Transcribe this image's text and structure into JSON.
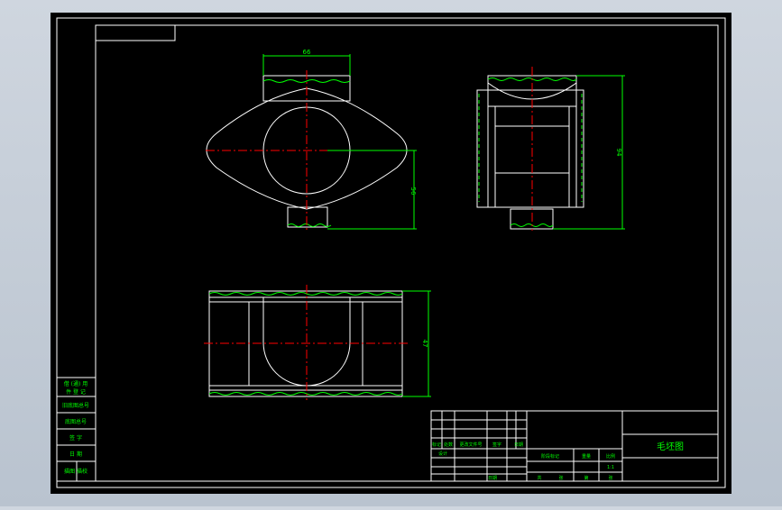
{
  "colors": {
    "background": "#000000",
    "frame": "#ffffff",
    "outline": "#ffffff",
    "dimension": "#00ff00",
    "centerline": "#ff0000",
    "text": "#00ff00",
    "desktop": "#c4ccd6"
  },
  "drawing": {
    "title": "毛坯图",
    "scale": "1:1",
    "dims": {
      "top_width": "66",
      "top_height": "56",
      "side_height": "94",
      "bottom_height": "47"
    }
  },
  "left_strip": {
    "rows": [
      "借 (通) 用",
      "件 登 记",
      "旧底图总号",
      "底图总号",
      "签  字",
      "日  期",
      "描图  描校"
    ]
  },
  "title_block": {
    "col_labels": [
      "标记",
      "处数",
      "更改文件号",
      "签字",
      "日期"
    ],
    "sub_labels": [
      "设计",
      "日期"
    ],
    "stage_labels": [
      "阶段标记",
      "重量",
      "比例"
    ],
    "sheet_labels": [
      "共",
      "张",
      "第",
      "张"
    ]
  }
}
